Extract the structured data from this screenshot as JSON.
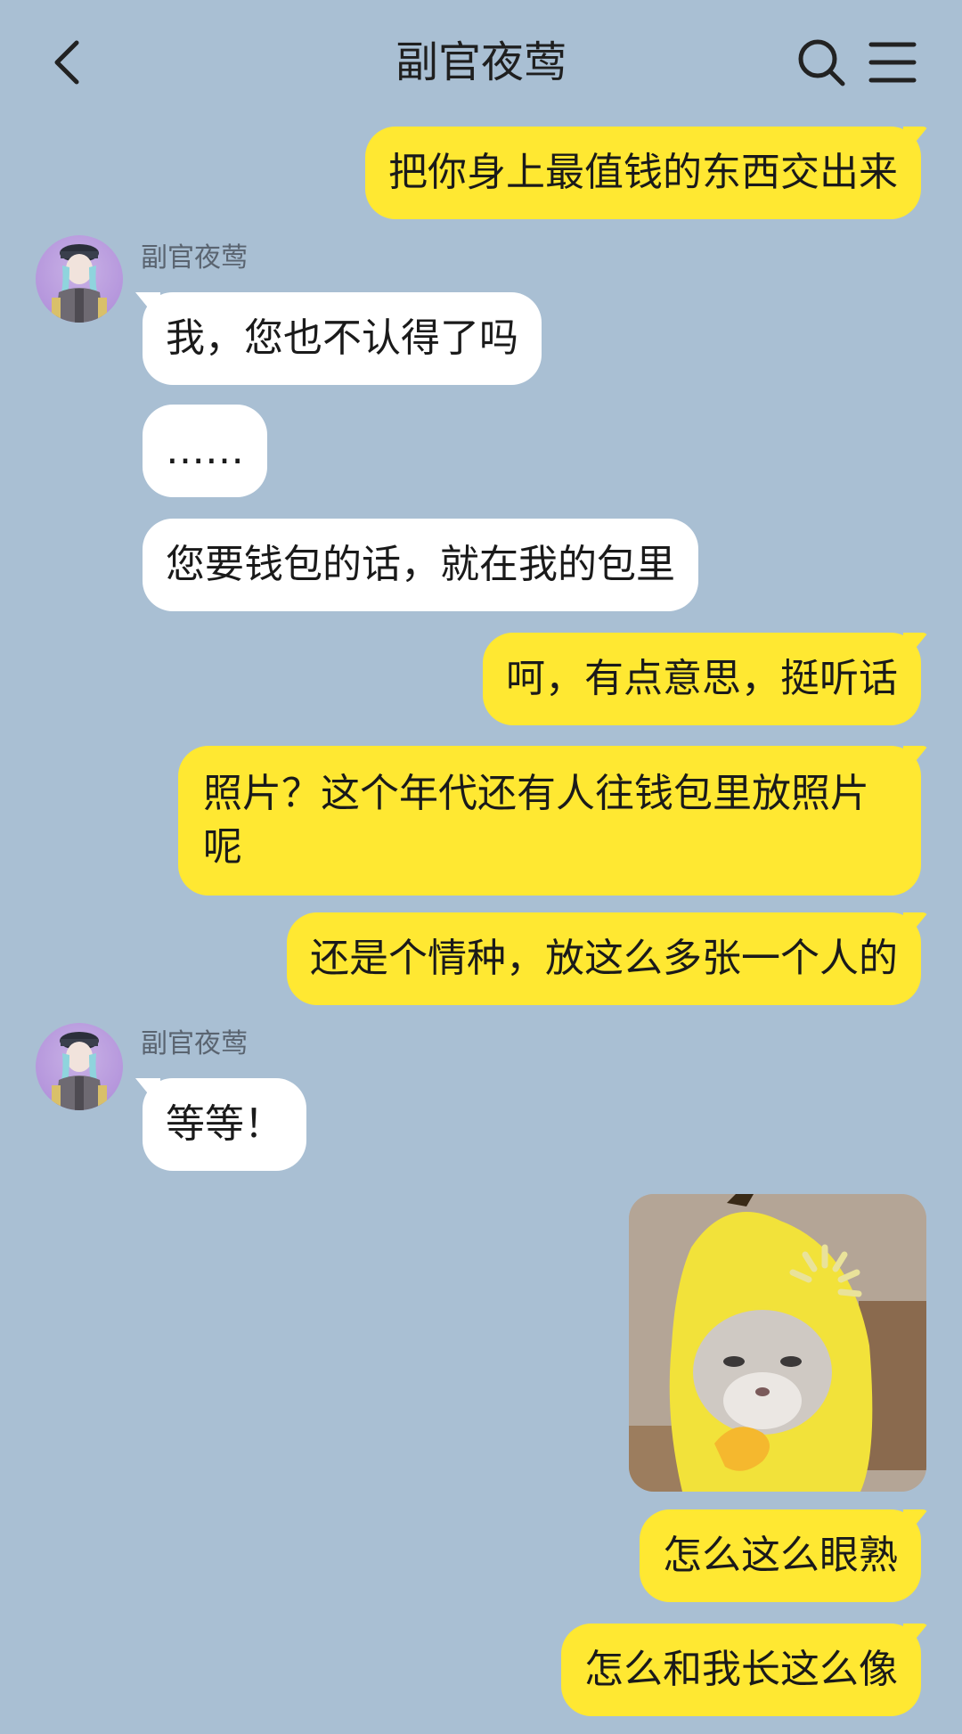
{
  "header": {
    "title": "副官夜莺",
    "back_icon": "chevron-left-icon",
    "search_icon": "search-icon",
    "menu_icon": "hamburger-menu-icon"
  },
  "contact": {
    "name": "副官夜莺"
  },
  "messages": [
    {
      "from": "me",
      "text": "把你身上最值钱的东西交出来"
    },
    {
      "from": "other",
      "sender": "副官夜莺",
      "text": "我，您也不认得了吗"
    },
    {
      "from": "other",
      "text": "……"
    },
    {
      "from": "other",
      "text": "您要钱包的话，就在我的包里"
    },
    {
      "from": "me",
      "text": "呵，有点意思，挺听话"
    },
    {
      "from": "me",
      "text": "照片？这个年代还有人往钱包里放照片呢"
    },
    {
      "from": "me",
      "text": "还是个情种，放这么多张一个人的"
    },
    {
      "from": "other",
      "sender": "副官夜莺",
      "text": "等等！"
    },
    {
      "from": "me",
      "sticker": "banana-cat-sticker"
    },
    {
      "from": "me",
      "text": "怎么这么眼熟"
    },
    {
      "from": "me",
      "text": "怎么和我长这么像"
    }
  ],
  "colors": {
    "background": "#a9bfd3",
    "my_bubble": "#ffe832",
    "other_bubble": "#ffffff"
  }
}
